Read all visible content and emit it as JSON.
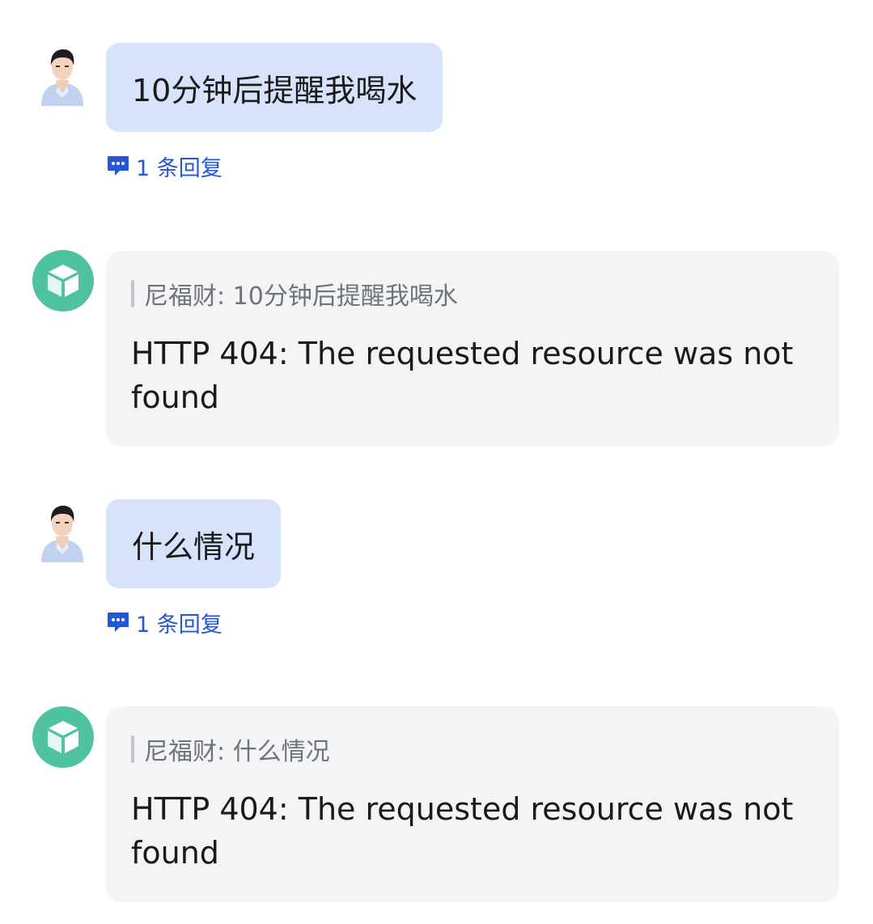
{
  "messages": [
    {
      "type": "user",
      "text": "10分钟后提醒我喝水",
      "reply_link": "1 条回复"
    },
    {
      "type": "bot",
      "quote": "尼福财: 10分钟后提醒我喝水",
      "text": "HTTP 404: The requested resource was not found"
    },
    {
      "type": "user",
      "text": "什么情况",
      "reply_link": "1 条回复"
    },
    {
      "type": "bot",
      "quote": "尼福财: 什么情况",
      "text": "HTTP 404: The requested resource was not found"
    }
  ],
  "colors": {
    "user_bubble": "#d6e3fb",
    "bot_bubble": "#f3f4f6",
    "reply_link": "#2456d6",
    "bot_avatar": "#4fc3a0",
    "quote_text": "#707378"
  },
  "icons": {
    "reply": "comment-dots-icon",
    "bot_avatar": "cube-icon"
  }
}
